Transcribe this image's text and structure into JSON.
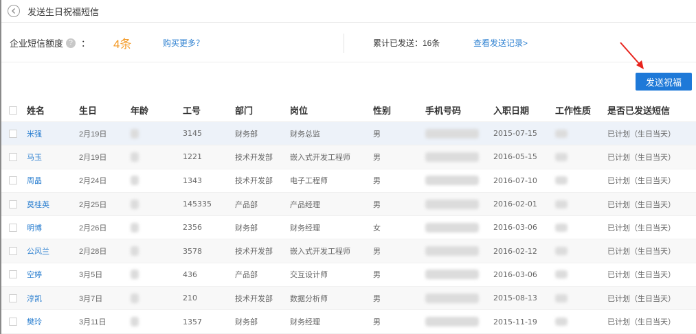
{
  "header": {
    "title": "发送生日祝福短信"
  },
  "quota": {
    "label": "企业短信额度",
    "colon": "：",
    "count": "4条",
    "buy_more": "购买更多？",
    "sent_total": "累计已发送：16条",
    "view_history": "查看发送记录>"
  },
  "actions": {
    "send_label": "发送祝福"
  },
  "colors": {
    "accent": "#1e79d8",
    "link": "#2b7fd0",
    "count": "#f39a27",
    "annotation_arrow": "#e8231c"
  },
  "table": {
    "columns": [
      "姓名",
      "生日",
      "年龄",
      "工号",
      "部门",
      "岗位",
      "性别",
      "手机号码",
      "入职日期",
      "工作性质",
      "是否已发送短信"
    ],
    "rows": [
      {
        "name": "米强",
        "birthday": "2月19日",
        "id": "3145",
        "dept": "财务部",
        "position": "财务总监",
        "sex": "男",
        "hire_date": "2015-07-15",
        "sms_status": "已计划（生日当天）"
      },
      {
        "name": "马玉",
        "birthday": "2月19日",
        "id": "1221",
        "dept": "技术开发部",
        "position": "嵌入式开发工程师",
        "sex": "男",
        "hire_date": "2016-05-15",
        "sms_status": "已计划（生日当天）"
      },
      {
        "name": "周晶",
        "birthday": "2月24日",
        "id": "1343",
        "dept": "技术开发部",
        "position": "电子工程师",
        "sex": "男",
        "hire_date": "2016-07-10",
        "sms_status": "已计划（生日当天）"
      },
      {
        "name": "莫桂英",
        "birthday": "2月25日",
        "id": "145335",
        "dept": "产品部",
        "position": "产品经理",
        "sex": "男",
        "hire_date": "2016-02-01",
        "sms_status": "已计划（生日当天）"
      },
      {
        "name": "明博",
        "birthday": "2月26日",
        "id": "2356",
        "dept": "财务部",
        "position": "财务经理",
        "sex": "女",
        "hire_date": "2016-03-06",
        "sms_status": "已计划（生日当天）"
      },
      {
        "name": "公风兰",
        "birthday": "2月28日",
        "id": "3578",
        "dept": "技术开发部",
        "position": "嵌入式开发工程师",
        "sex": "男",
        "hire_date": "2016-02-12",
        "sms_status": "已计划（生日当天）"
      },
      {
        "name": "空婷",
        "birthday": "3月5日",
        "id": "436",
        "dept": "产品部",
        "position": "交互设计师",
        "sex": "男",
        "hire_date": "2016-03-06",
        "sms_status": "已计划（生日当天）"
      },
      {
        "name": "淳凯",
        "birthday": "3月7日",
        "id": "210",
        "dept": "技术开发部",
        "position": "数据分析师",
        "sex": "男",
        "hire_date": "2015-08-13",
        "sms_status": "已计划（生日当天）"
      },
      {
        "name": "樊玲",
        "birthday": "3月11日",
        "id": "1357",
        "dept": "财务部",
        "position": "财务经理",
        "sex": "男",
        "hire_date": "2015-11-19",
        "sms_status": "已计划（生日当天）"
      }
    ]
  }
}
